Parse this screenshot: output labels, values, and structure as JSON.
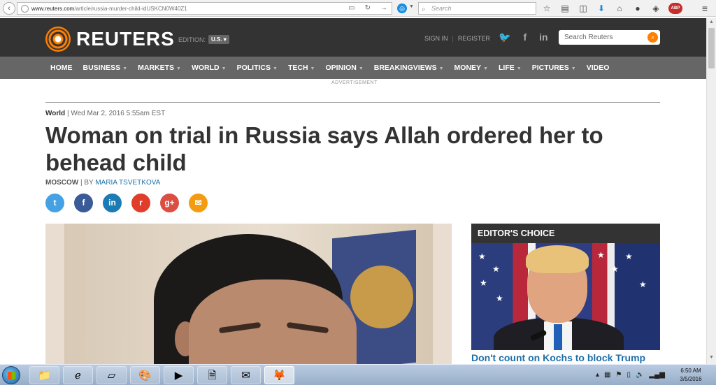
{
  "browser": {
    "url_domain": "www.reuters.com",
    "url_path": "/article/russia-murder-child-idUSKCN0W40Z1",
    "search_placeholder": "Search",
    "abp_label": "ABP"
  },
  "site": {
    "logo": "REUTERS",
    "edition_label": "EDITION:",
    "edition_value": "U.S.",
    "sign_in": "SIGN IN",
    "register": "REGISTER",
    "search_placeholder": "Search Reuters",
    "nav": [
      {
        "label": "HOME",
        "dropdown": false
      },
      {
        "label": "BUSINESS",
        "dropdown": true
      },
      {
        "label": "MARKETS",
        "dropdown": true
      },
      {
        "label": "WORLD",
        "dropdown": true
      },
      {
        "label": "POLITICS",
        "dropdown": true
      },
      {
        "label": "TECH",
        "dropdown": true
      },
      {
        "label": "OPINION",
        "dropdown": true
      },
      {
        "label": "BREAKINGVIEWS",
        "dropdown": true
      },
      {
        "label": "MONEY",
        "dropdown": true
      },
      {
        "label": "LIFE",
        "dropdown": true
      },
      {
        "label": "PICTURES",
        "dropdown": true
      },
      {
        "label": "VIDEO",
        "dropdown": false
      }
    ],
    "advertisement": "ADVERTISEMENT"
  },
  "article": {
    "section": "World",
    "date": "| Wed Mar 2, 2016 5:55am EST",
    "headline": "Woman on trial in Russia says Allah ordered her to behead child",
    "location": "MOSCOW",
    "by": "| BY",
    "author": "MARIA TSVETKOVA",
    "share": [
      {
        "name": "twitter-share-icon",
        "glyph": "t",
        "color": "#44a2e4"
      },
      {
        "name": "facebook-share-icon",
        "glyph": "f",
        "color": "#3a5a98"
      },
      {
        "name": "linkedin-share-icon",
        "glyph": "in",
        "color": "#1b7bb4"
      },
      {
        "name": "reddit-share-icon",
        "glyph": "r",
        "color": "#e03d2a"
      },
      {
        "name": "googleplus-share-icon",
        "glyph": "g+",
        "color": "#dc4e41"
      },
      {
        "name": "email-share-icon",
        "glyph": "✉",
        "color": "#f39c12"
      }
    ]
  },
  "editors_choice": {
    "title": "EDITOR'S CHOICE",
    "link": "Don't count on Kochs to block Trump"
  },
  "taskbar": {
    "time": "6:50 AM",
    "date": "3/5/2016"
  }
}
